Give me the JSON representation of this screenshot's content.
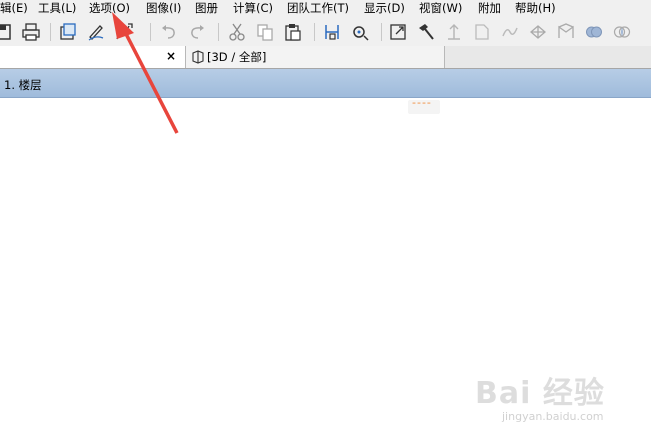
{
  "menubar": {
    "items": [
      {
        "label": "辑(E)"
      },
      {
        "label": "工具(L)"
      },
      {
        "label": "选项(O)"
      },
      {
        "label": "图像(I)"
      },
      {
        "label": "图册"
      },
      {
        "label": "计算(C)"
      },
      {
        "label": "团队工作(T)"
      },
      {
        "label": "显示(D)"
      },
      {
        "label": "视窗(W)"
      },
      {
        "label": "附加"
      },
      {
        "label": "帮助(H)"
      }
    ]
  },
  "tabs": {
    "blank_close": "×",
    "view3d_label": "[3D / 全部]"
  },
  "viewport": {
    "title": "1. 楼层",
    "dash_tag": "----"
  },
  "watermark": {
    "main": "Bai 经验",
    "sub": "jingyan.baidu.com"
  },
  "colors": {
    "arrow": "#e8453c",
    "header": "#a8c2df",
    "dash": "#f08a3a"
  }
}
